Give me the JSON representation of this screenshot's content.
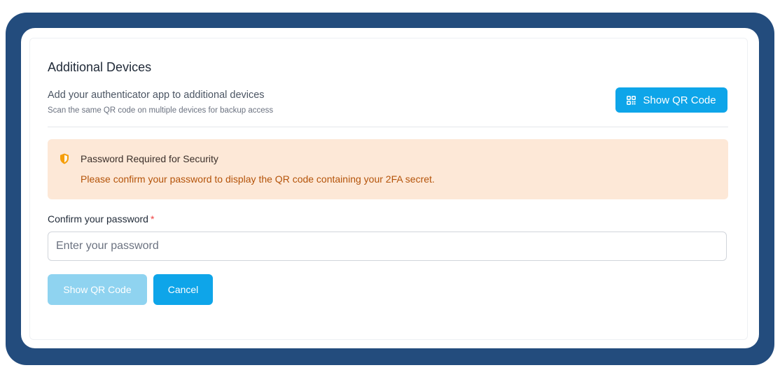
{
  "section": {
    "title": "Additional Devices",
    "description": "Add your authenticator app to additional devices",
    "subdescription": "Scan the same QR code on multiple devices for backup access",
    "show_qr_button_label": "Show QR Code",
    "show_qr_button_icon": "qr-code-icon"
  },
  "alert": {
    "icon": "shield-icon",
    "title": "Password Required for Security",
    "message": "Please confirm your password to display the QR code containing your 2FA secret.",
    "background": "#fde8d7",
    "icon_color": "#f59e0b"
  },
  "password_field": {
    "label": "Confirm your password",
    "required_marker": "*",
    "placeholder": "Enter your password",
    "value": ""
  },
  "actions": {
    "submit_label": "Show QR Code",
    "submit_disabled": true,
    "cancel_label": "Cancel"
  },
  "colors": {
    "frame": "#234c7d",
    "accent": "#0ea5e9",
    "accent_disabled": "#8fd3f0",
    "required": "#ef4444"
  }
}
